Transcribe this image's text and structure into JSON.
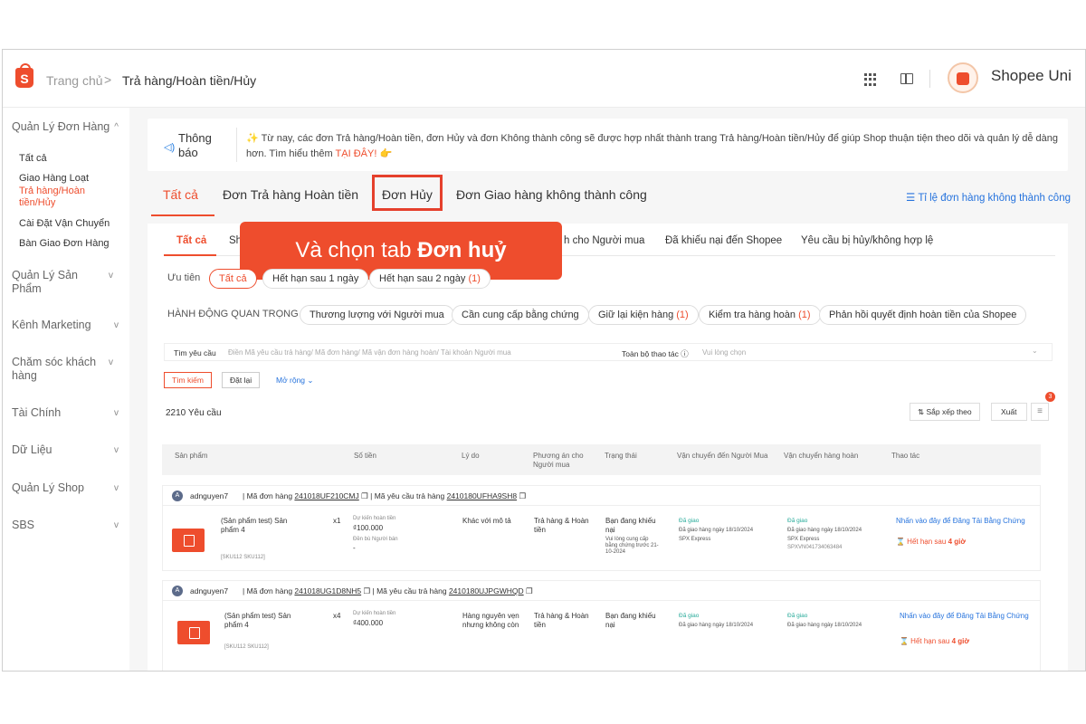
{
  "topbar": {
    "breadcrumb_home": "Trang chủ",
    "breadcrumb_sep": ">",
    "breadcrumb_current": "Trả hàng/Hoàn tiền/Hủy",
    "brand": "Shopee Uni",
    "logo_letter": "S"
  },
  "sidebar": {
    "g1": "Quản Lý Đơn Hàng",
    "g1_items": [
      "Tất cả",
      "Giao Hàng Loạt",
      "Trả hàng/Hoàn tiền/Hủy",
      "Cài Đặt Vận Chuyển",
      "Bàn Giao Đơn Hàng"
    ],
    "g2": "Quản Lý Sản Phẩm",
    "g3": "Kênh Marketing",
    "g4": "Chăm sóc khách hàng",
    "g5": "Tài Chính",
    "g6": "Dữ Liệu",
    "g7": "Quản Lý Shop",
    "g8": "SBS",
    "chev_up": "^",
    "chev_down": "v"
  },
  "notice": {
    "label": "Thông báo",
    "text": "Từ nay, các đơn Trả hàng/Hoàn tiền, đơn Hủy và đơn Không thành công sẽ được hợp nhất thành trang Trả hàng/Hoàn tiền/Hủy để giúp Shop thuận tiện theo dõi và quản lý dễ dàng hơn. Tìm hiểu thêm",
    "link": "TẠI ĐÂY!",
    "spark": "✨",
    "hand": "👉"
  },
  "tabs": [
    "Tất cả",
    "Đơn Trả hàng Hoàn tiền",
    "Đơn Hủy",
    "Đơn Giao hàng không thành công"
  ],
  "rate_link": "☰ Tỉ lệ đơn hàng không thành công",
  "subtabs": [
    "Tất cả",
    "Sh",
    "h cho Người mua",
    "Đã khiếu nại đến Shopee",
    "Yêu cầu bị hủy/không hợp lệ"
  ],
  "callout": {
    "text": "Và chọn tab",
    "bold": "Đơn huỷ"
  },
  "priority": {
    "label": "Ưu tiên",
    "pills": [
      "Tất cả",
      "Hết hạn sau 1 ngày",
      "Hết hạn sau 2 ngày"
    ],
    "pill3_count": "(1)"
  },
  "actions": {
    "label": "HÀNH ĐỘNG QUAN TRỌNG",
    "pills": [
      "Thương lượng với Người mua",
      "Cần cung cấp bằng chứng",
      "Giữ lại kiện hàng",
      "Kiểm tra hàng hoàn",
      "Phản hồi quyết định hoàn tiền của Shopee"
    ],
    "count_keep": "(1)",
    "count_check": "(1)"
  },
  "filter": {
    "label": "Tìm yêu cầu",
    "placeholder": "Điền Mã yêu cầu trả hàng/ Mã đơn hàng/ Mã vận đơn hàng hoàn/ Tài khoản Người mua",
    "action_label": "Toàn bộ thao tác ⓘ",
    "action_placeholder": "Vui lòng chọn",
    "chevron": "⌄"
  },
  "buttons": {
    "search": "Tìm kiếm",
    "reset": "Đặt lại",
    "more": "Mở rộng ⌄"
  },
  "count": "2210 Yêu cầu",
  "toolbar": {
    "sort": "⇅ Sắp xếp theo",
    "export": "Xuất",
    "list": "≡",
    "badge": "3"
  },
  "columns": [
    "Sản phẩm",
    "Số tiền",
    "Lý do",
    "Phương án cho Người mua",
    "Trạng thái",
    "Vận chuyển đến Người Mua",
    "Vận chuyển hàng hoàn",
    "Thao tác"
  ],
  "orders": [
    {
      "avatar": "A",
      "user": "adnguyen7",
      "order_label": "Mã đơn hàng",
      "order_id": "241018UF210CMJ",
      "req_label": "Mã yêu cầu trả hàng",
      "req_id": "2410180UFHA9SH8",
      "copy_icon": "❐",
      "product": "(Sản phẩm test) Sản phẩm 4",
      "sku": "[SKU112 SKU112]",
      "qty": "x1",
      "amount_label": "Dự kiến hoàn tiền",
      "amount": "₫100.000",
      "comp_label": "Đền bù Người bán",
      "comp": "-",
      "reason": "Khác với mô tả",
      "solution": "Trả hàng & Hoàn tiền",
      "status": "Bạn đang khiếu nại",
      "status_note": "Vui lòng cung cấp bằng chứng trước 21-10-2024",
      "ship_status": "Đã giao",
      "ship_date": "Đã giao hàng ngày 18/10/2024",
      "ship_carrier": "SPX Express",
      "ret_status": "Đã giao",
      "ret_date": "Đã giao hàng ngày 18/10/2024",
      "ret_carrier": "SPX Express",
      "ret_tracking": "SPXVN041734063484",
      "action": "Nhấn vào đây để Đăng Tải Bằng Chứng",
      "deadline": "⌛ Hết hạn sau",
      "deadline_bold": "4 giờ"
    },
    {
      "avatar": "A",
      "user": "adnguyen7",
      "order_label": "Mã đơn hàng",
      "order_id": "241018UG1D8NH5",
      "req_label": "Mã yêu cầu trả hàng",
      "req_id": "2410180UJPGWHQD",
      "copy_icon": "❐",
      "product": "(Sản phẩm test) Sản phẩm 4",
      "sku": "[SKU112 SKU112]",
      "qty": "x4",
      "amount_label": "Dự kiến hoàn tiền",
      "amount": "₫400.000",
      "reason": "Hàng nguyên vẹn nhưng không còn",
      "solution": "Trả hàng & Hoàn tiền",
      "status": "Bạn đang khiếu nại",
      "ship_status": "Đã giao",
      "ship_date": "Đã giao hàng ngày 18/10/2024",
      "ret_status": "Đã giao",
      "ret_date": "Đã giao hàng ngày 18/10/2024",
      "action": "Nhấn vào đây để Đăng Tải Bằng Chứng",
      "deadline": "⌛ Hết hạn sau",
      "deadline_bold": "4 giờ"
    }
  ],
  "colors": {
    "accent": "#ee4d2d",
    "link": "#2673dd",
    "success": "#26aa99"
  }
}
